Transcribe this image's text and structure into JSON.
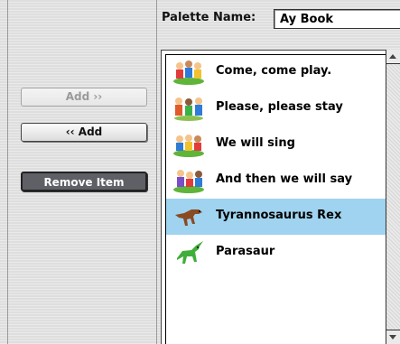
{
  "palette": {
    "label": "Palette Name:",
    "value": "Ay Book"
  },
  "buttons": {
    "add_right": "Add ››",
    "add_left": "‹‹ Add",
    "remove": "Remove Item"
  },
  "list": {
    "items": [
      {
        "label": "Come, come play.",
        "icon": "kids-playing-icon"
      },
      {
        "label": "Please, please stay",
        "icon": "kids-group-icon"
      },
      {
        "label": "We will sing",
        "icon": "kids-singing-icon"
      },
      {
        "label": "And then we will say",
        "icon": "kids-playing-icon"
      },
      {
        "label": "Tyrannosaurus Rex",
        "icon": "tyrannosaurus-icon",
        "selected": true
      },
      {
        "label": "Parasaur",
        "icon": "parasaurolophus-icon"
      }
    ]
  },
  "colors": {
    "selection": "#9fd3ef",
    "remove_button": "#5e6066"
  }
}
